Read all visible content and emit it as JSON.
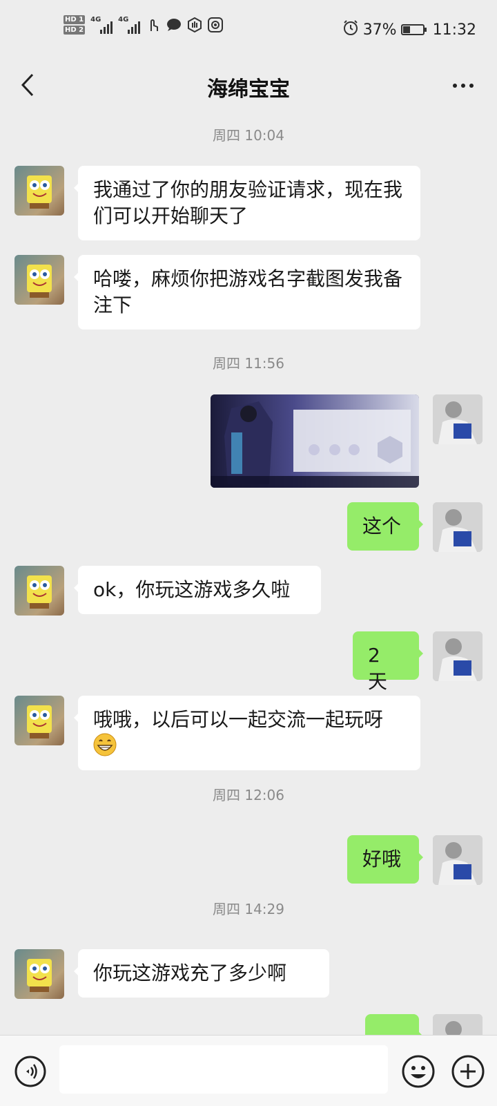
{
  "status_bar": {
    "hd1": "HD 1",
    "hd2": "HD 2",
    "net1": "4G",
    "net2": "4G",
    "battery_percent": "37%",
    "battery_level": 0.37,
    "time": "11:32",
    "icons": [
      "touch-icon",
      "chat-bubble-icon",
      "hand-icon",
      "target-icon",
      "alarm-icon"
    ]
  },
  "header": {
    "title": "海绵宝宝",
    "back_icon": "chevron-left-icon",
    "more_icon": "more-dots-icon"
  },
  "messages": [
    {
      "type": "timestamp",
      "text": "周四 10:04"
    },
    {
      "type": "text",
      "from": "other",
      "text": "我通过了你的朋友验证请求，现在我们可以开始聊天了"
    },
    {
      "type": "text",
      "from": "other",
      "text": "哈喽，麻烦你把游戏名字截图发我备注下"
    },
    {
      "type": "timestamp",
      "text": "周四 11:56"
    },
    {
      "type": "image",
      "from": "me",
      "content": "game-screenshot"
    },
    {
      "type": "text",
      "from": "me",
      "text": "这个"
    },
    {
      "type": "text",
      "from": "other",
      "text": "ok，你玩这游戏多久啦"
    },
    {
      "type": "text",
      "from": "me",
      "text": "2 天"
    },
    {
      "type": "text",
      "from": "other",
      "text": "哦哦，以后可以一起交流一起玩呀",
      "emoji": "grin-emoji"
    },
    {
      "type": "timestamp",
      "text": "周四 12:06"
    },
    {
      "type": "text",
      "from": "me",
      "text": "好哦"
    },
    {
      "type": "timestamp",
      "text": "周四 14:29"
    },
    {
      "type": "text",
      "from": "other",
      "text": "你玩这游戏充了多少啊"
    },
    {
      "type": "text",
      "from": "me",
      "text": "",
      "partially_hidden": true
    }
  ],
  "bottom_bar": {
    "voice_icon": "voice-icon",
    "input_placeholder": "",
    "emoji_icon": "emoji-icon",
    "plus_icon": "plus-icon"
  },
  "colors": {
    "background": "#ededed",
    "incoming_bubble": "#ffffff",
    "outgoing_bubble": "#95ec69",
    "timestamp_text": "#8a8a8a"
  }
}
